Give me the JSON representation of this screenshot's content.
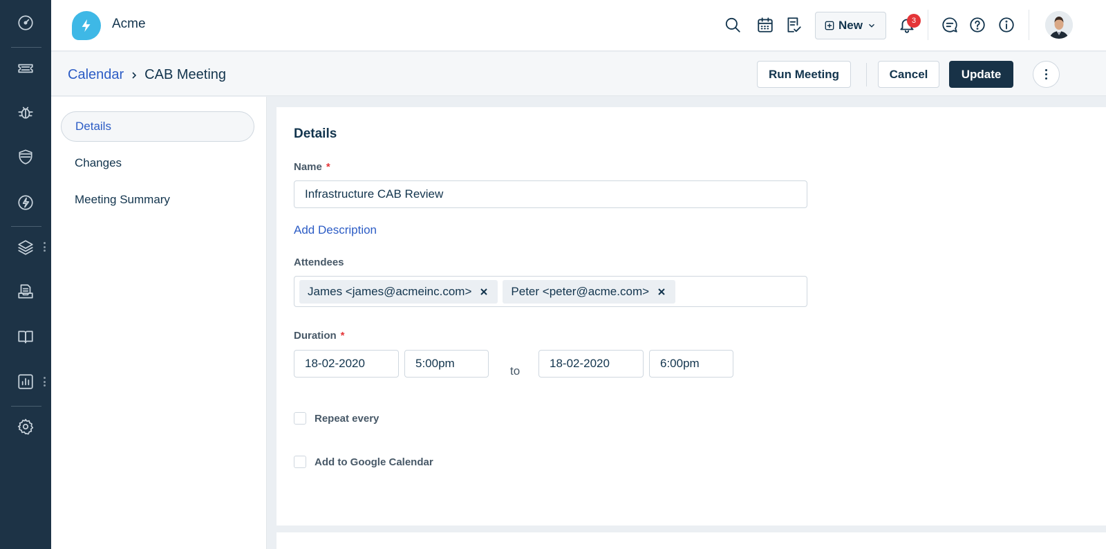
{
  "app": {
    "brand_name": "Acme",
    "accent": "#2c5cc5",
    "primary": "#183247",
    "logo_color": "#3eb8e6"
  },
  "rail": {
    "items": [
      {
        "name": "dashboard",
        "icon": "dashboard-gauge-icon"
      },
      {
        "name": "tickets",
        "icon": "ticket-icon"
      },
      {
        "name": "problems",
        "icon": "bug-icon"
      },
      {
        "name": "changes",
        "icon": "shield-icon"
      },
      {
        "name": "releases",
        "icon": "lightning-icon"
      },
      {
        "name": "assets",
        "icon": "layers-icon"
      },
      {
        "name": "purchase-orders",
        "icon": "inbox-tray-icon"
      },
      {
        "name": "solutions",
        "icon": "book-icon"
      },
      {
        "name": "reports",
        "icon": "bar-chart-icon"
      },
      {
        "name": "admin",
        "icon": "gear-icon"
      }
    ]
  },
  "topbar": {
    "new_label": "New",
    "notification_count": "3",
    "icons": [
      "search-icon",
      "calendar-icon",
      "checklist-icon",
      "bell-icon",
      "chat-icon",
      "help-icon",
      "info-icon"
    ]
  },
  "header": {
    "breadcrumb_parent": "Calendar",
    "breadcrumb_current": "CAB Meeting",
    "run_meeting_label": "Run Meeting",
    "cancel_label": "Cancel",
    "update_label": "Update"
  },
  "leftnav": {
    "items": [
      {
        "label": "Details",
        "active": true
      },
      {
        "label": "Changes",
        "active": false
      },
      {
        "label": "Meeting Summary",
        "active": false
      }
    ]
  },
  "form": {
    "title": "Details",
    "name_label": "Name",
    "required_mark": "*",
    "name_value": "Infrastructure CAB Review",
    "add_description": "Add Description",
    "attendees_label": "Attendees",
    "attendees": [
      "James <james@acmeinc.com>",
      "Peter <peter@acme.com>"
    ],
    "duration_label": "Duration",
    "start_date": "18-02-2020",
    "start_time": "5:00pm",
    "to_label": "to",
    "end_date": "18-02-2020",
    "end_time": "6:00pm",
    "repeat_label": "Repeat every",
    "google_label": "Add to Google Calendar"
  }
}
